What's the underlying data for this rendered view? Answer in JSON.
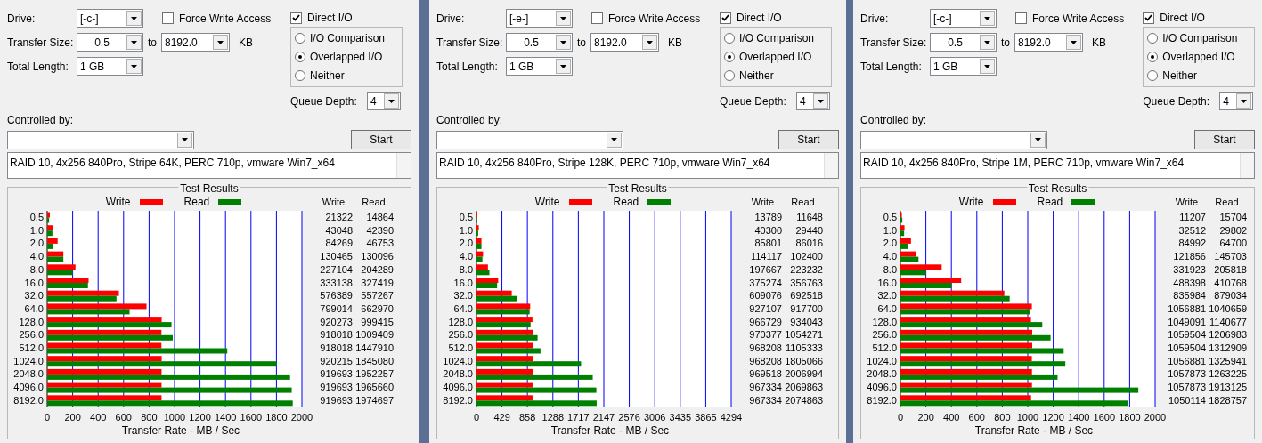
{
  "panels": [
    {
      "drive_label": "Drive:",
      "drive": "[-c-]",
      "force_write": {
        "label": "Force Write Access",
        "checked": false
      },
      "direct_io": {
        "label": "Direct I/O",
        "checked": true
      },
      "transfer_label": "Transfer Size:",
      "transfer_from": "0.5",
      "to_label": "to",
      "transfer_to": "8192.0",
      "unit": "KB",
      "length_label": "Total Length:",
      "total_length": "1 GB",
      "io_modes": [
        {
          "label": "I/O Comparison",
          "selected": false
        },
        {
          "label": "Overlapped I/O",
          "selected": true
        },
        {
          "label": "Neither",
          "selected": false
        }
      ],
      "queue_label": "Queue Depth:",
      "queue_depth": "4",
      "controlled_label": "Controlled by:",
      "start": "Start",
      "description": "RAID 10, 4x256 840Pro, Stripe 64K, PERC 710p, vmware Win7_x64",
      "results": {
        "title": "Test Results",
        "columns": [
          "Write",
          "Read"
        ],
        "rows": [
          {
            "write": "21322",
            "read": "14864"
          },
          {
            "write": "43048",
            "read": "42390"
          },
          {
            "write": "84269",
            "read": "46753"
          },
          {
            "write": "130465",
            "read": "130096"
          },
          {
            "write": "227104",
            "read": "204289"
          },
          {
            "write": "333138",
            "read": "327419"
          },
          {
            "write": "576389",
            "read": "557267"
          },
          {
            "write": "799014",
            "read": "662970"
          },
          {
            "write": "920273",
            "read": "999415"
          },
          {
            "write": "918018",
            "read": "1009409"
          },
          {
            "write": "918018",
            "read": "1447910"
          },
          {
            "write": "920215",
            "read": "1845080"
          },
          {
            "write": "919693",
            "read": "1952257"
          },
          {
            "write": "919693",
            "read": "1965660"
          },
          {
            "write": "919693",
            "read": "1974697"
          }
        ],
        "chart_data": {
          "type": "bar",
          "orientation": "horizontal",
          "xlabel": "Transfer Rate - MB / Sec",
          "categories": [
            "0.5",
            "1.0",
            "2.0",
            "4.0",
            "8.0",
            "16.0",
            "32.0",
            "64.0",
            "128.0",
            "256.0",
            "512.0",
            "1024.0",
            "2048.0",
            "4096.0",
            "8192.0"
          ],
          "series": [
            {
              "name": "Write",
              "color": "#ff0000",
              "values": [
                21,
                42,
                82,
                127,
                222,
                325,
                563,
                780,
                899,
                897,
                897,
                899,
                898,
                898,
                898
              ]
            },
            {
              "name": "Read",
              "color": "#008000",
              "values": [
                15,
                41,
                46,
                127,
                200,
                320,
                544,
                647,
                976,
                986,
                1414,
                1802,
                1907,
                1920,
                1928
              ]
            }
          ],
          "xlim": [
            0,
            2000
          ],
          "xticks": [
            0,
            200,
            400,
            600,
            800,
            1000,
            1200,
            1400,
            1600,
            1800,
            2000
          ],
          "grid": true
        }
      }
    },
    {
      "drive_label": "Drive:",
      "drive": "[-e-]",
      "force_write": {
        "label": "Force Write Access",
        "checked": false
      },
      "direct_io": {
        "label": "Direct I/O",
        "checked": true
      },
      "transfer_label": "Transfer Size:",
      "transfer_from": "0.5",
      "to_label": "to",
      "transfer_to": "8192.0",
      "unit": "KB",
      "length_label": "Total Length:",
      "total_length": "1 GB",
      "io_modes": [
        {
          "label": "I/O Comparison",
          "selected": false
        },
        {
          "label": "Overlapped I/O",
          "selected": true
        },
        {
          "label": "Neither",
          "selected": false
        }
      ],
      "queue_label": "Queue Depth:",
      "queue_depth": "4",
      "controlled_label": "Controlled by:",
      "start": "Start",
      "description": "RAID 10, 4x256 840Pro, Stripe 128K, PERC 710p, vmware Win7_x64",
      "results": {
        "title": "Test Results",
        "columns": [
          "Write",
          "Read"
        ],
        "rows": [
          {
            "write": "13789",
            "read": "11648"
          },
          {
            "write": "40300",
            "read": "29440"
          },
          {
            "write": "85801",
            "read": "86016"
          },
          {
            "write": "114117",
            "read": "102400"
          },
          {
            "write": "197667",
            "read": "223232"
          },
          {
            "write": "375274",
            "read": "356763"
          },
          {
            "write": "609076",
            "read": "692518"
          },
          {
            "write": "927107",
            "read": "917700"
          },
          {
            "write": "966729",
            "read": "934043"
          },
          {
            "write": "970377",
            "read": "1054271"
          },
          {
            "write": "968208",
            "read": "1105333"
          },
          {
            "write": "968208",
            "read": "1805066"
          },
          {
            "write": "969518",
            "read": "2006994"
          },
          {
            "write": "967334",
            "read": "2069863"
          },
          {
            "write": "967334",
            "read": "2074863"
          }
        ],
        "chart_data": {
          "type": "bar",
          "orientation": "horizontal",
          "xlabel": "Transfer Rate - MB / Sec",
          "categories": [
            "0.5",
            "1.0",
            "2.0",
            "4.0",
            "8.0",
            "16.0",
            "32.0",
            "64.0",
            "128.0",
            "256.0",
            "512.0",
            "1024.0",
            "2048.0",
            "4096.0",
            "8192.0"
          ],
          "series": [
            {
              "name": "Write",
              "color": "#ff0000",
              "values": [
                13,
                39,
                84,
                111,
                193,
                366,
                595,
                905,
                944,
                948,
                946,
                946,
                947,
                945,
                945
              ]
            },
            {
              "name": "Read",
              "color": "#008000",
              "values": [
                11,
                29,
                84,
                100,
                218,
                348,
                676,
                896,
                912,
                1030,
                1079,
                1763,
                1960,
                2021,
                2026
              ]
            }
          ],
          "xlim": [
            0,
            4294
          ],
          "xticks": [
            0,
            429,
            858,
            1288,
            1717,
            2147,
            2576,
            3006,
            3435,
            3865,
            4294
          ],
          "grid": true
        }
      }
    },
    {
      "drive_label": "Drive:",
      "drive": "[-c-]",
      "force_write": {
        "label": "Force Write Access",
        "checked": false
      },
      "direct_io": {
        "label": "Direct I/O",
        "checked": true
      },
      "transfer_label": "Transfer Size:",
      "transfer_from": "0.5",
      "to_label": "to",
      "transfer_to": "8192.0",
      "unit": "KB",
      "length_label": "Total Length:",
      "total_length": "1 GB",
      "io_modes": [
        {
          "label": "I/O Comparison",
          "selected": false
        },
        {
          "label": "Overlapped I/O",
          "selected": true
        },
        {
          "label": "Neither",
          "selected": false
        }
      ],
      "queue_label": "Queue Depth:",
      "queue_depth": "4",
      "controlled_label": "Controlled by:",
      "start": "Start",
      "description": "RAID 10, 4x256 840Pro, Stripe 1M, PERC 710p, vmware Win7_x64",
      "results": {
        "title": "Test Results",
        "columns": [
          "Write",
          "Read"
        ],
        "rows": [
          {
            "write": "11207",
            "read": "15704"
          },
          {
            "write": "32512",
            "read": "29802"
          },
          {
            "write": "84992",
            "read": "64700"
          },
          {
            "write": "121856",
            "read": "145703"
          },
          {
            "write": "331923",
            "read": "205818"
          },
          {
            "write": "488398",
            "read": "410768"
          },
          {
            "write": "835984",
            "read": "879034"
          },
          {
            "write": "1056881",
            "read": "1040659"
          },
          {
            "write": "1049091",
            "read": "1140677"
          },
          {
            "write": "1059504",
            "read": "1206983"
          },
          {
            "write": "1059504",
            "read": "1312909"
          },
          {
            "write": "1056881",
            "read": "1325941"
          },
          {
            "write": "1057873",
            "read": "1263225"
          },
          {
            "write": "1057873",
            "read": "1913125"
          },
          {
            "write": "1050114",
            "read": "1828757"
          }
        ],
        "chart_data": {
          "type": "bar",
          "orientation": "horizontal",
          "xlabel": "Transfer Rate - MB / Sec",
          "categories": [
            "0.5",
            "1.0",
            "2.0",
            "4.0",
            "8.0",
            "16.0",
            "32.0",
            "64.0",
            "128.0",
            "256.0",
            "512.0",
            "1024.0",
            "2048.0",
            "4096.0",
            "8192.0"
          ],
          "series": [
            {
              "name": "Write",
              "color": "#ff0000",
              "values": [
                11,
                32,
                83,
                119,
                324,
                477,
                816,
                1032,
                1025,
                1035,
                1035,
                1032,
                1033,
                1033,
                1026
              ]
            },
            {
              "name": "Read",
              "color": "#008000",
              "values": [
                15,
                29,
                63,
                142,
                201,
                401,
                858,
                1016,
                1114,
                1179,
                1282,
                1295,
                1234,
                1868,
                1786
              ]
            }
          ],
          "xlim": [
            0,
            2000
          ],
          "xticks": [
            0,
            200,
            400,
            600,
            800,
            1000,
            1200,
            1400,
            1600,
            1800,
            2000
          ],
          "grid": true
        }
      }
    }
  ]
}
